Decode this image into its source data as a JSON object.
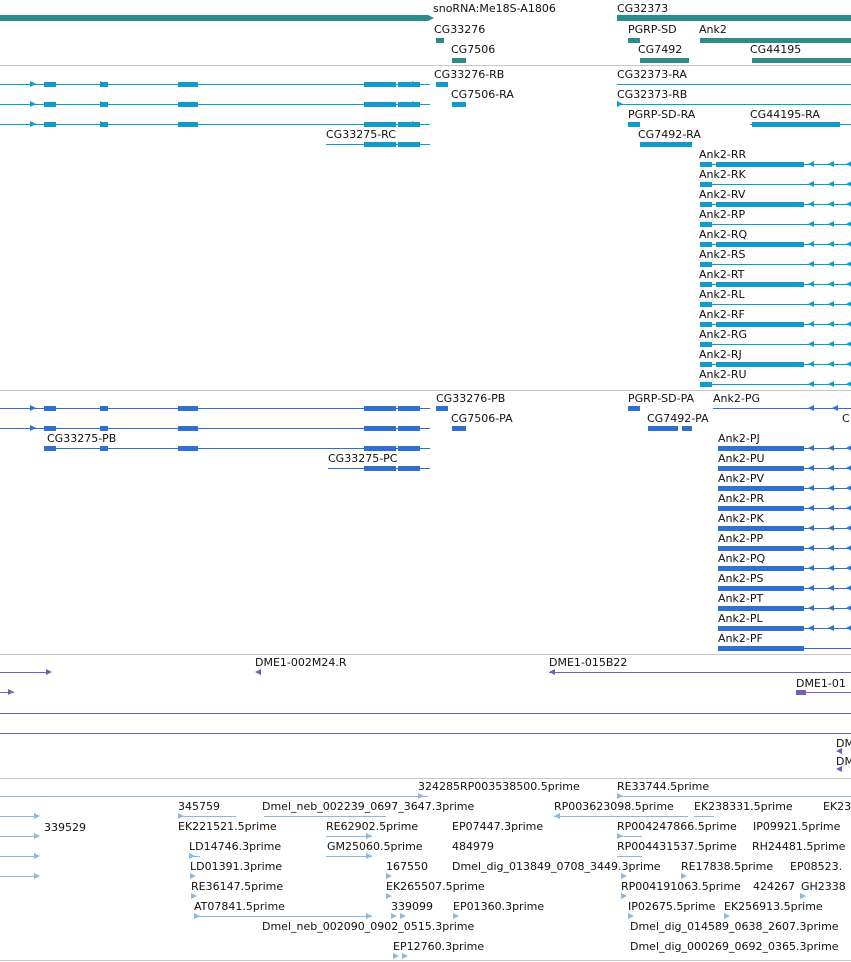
{
  "colors": {
    "gene": "#2e8b8b",
    "mrna": "#0e9ccc",
    "protein": "#2f6fd0",
    "clone": "#7a5cb8",
    "est": "#8ab8de",
    "divider": "#c8c8c8"
  },
  "tracks": [
    {
      "name": "genes",
      "color_key": "gene",
      "labels": [
        {
          "id": "g1",
          "text": "snoRNA:Me18S-A1806",
          "interactable": true
        },
        {
          "id": "g2",
          "text": "CG32373",
          "interactable": true
        },
        {
          "id": "g3",
          "text": "CG33276",
          "interactable": true
        },
        {
          "id": "g4",
          "text": "PGRP-SD",
          "interactable": true
        },
        {
          "id": "g5",
          "text": "Ank2",
          "interactable": true
        },
        {
          "id": "g6",
          "text": "CG7506",
          "interactable": true
        },
        {
          "id": "g7",
          "text": "CG7492",
          "interactable": true
        },
        {
          "id": "g8",
          "text": "CG44195",
          "interactable": true
        }
      ]
    },
    {
      "name": "transcripts",
      "color_key": "mrna",
      "labels": [
        {
          "id": "t1",
          "text": "CG33276-RB"
        },
        {
          "id": "t2",
          "text": "CG32373-RA"
        },
        {
          "id": "t3",
          "text": "CG7506-RA"
        },
        {
          "id": "t4",
          "text": "CG32373-RB"
        },
        {
          "id": "t5",
          "text": "PGRP-SD-RA"
        },
        {
          "id": "t6",
          "text": "CG44195-RA"
        },
        {
          "id": "t7",
          "text": "CG33275-RC"
        },
        {
          "id": "t8",
          "text": "CG7492-RA"
        },
        {
          "id": "t9",
          "text": "Ank2-RR"
        },
        {
          "id": "t10",
          "text": "Ank2-RK"
        },
        {
          "id": "t11",
          "text": "Ank2-RV"
        },
        {
          "id": "t12",
          "text": "Ank2-RP"
        },
        {
          "id": "t13",
          "text": "Ank2-RQ"
        },
        {
          "id": "t14",
          "text": "Ank2-RS"
        },
        {
          "id": "t15",
          "text": "Ank2-RT"
        },
        {
          "id": "t16",
          "text": "Ank2-RL"
        },
        {
          "id": "t17",
          "text": "Ank2-RF"
        },
        {
          "id": "t18",
          "text": "Ank2-RG"
        },
        {
          "id": "t19",
          "text": "Ank2-RJ"
        },
        {
          "id": "t20",
          "text": "Ank2-RU"
        }
      ]
    },
    {
      "name": "proteins",
      "color_key": "protein",
      "labels": [
        {
          "id": "p1",
          "text": "CG33276-PB"
        },
        {
          "id": "p2",
          "text": "PGRP-SD-PA"
        },
        {
          "id": "p3",
          "text": "Ank2-PG"
        },
        {
          "id": "p4",
          "text": "CG7506-PA"
        },
        {
          "id": "p5",
          "text": "CG7492-PA"
        },
        {
          "id": "p6",
          "text": "C"
        },
        {
          "id": "p7",
          "text": "CG33275-PB"
        },
        {
          "id": "p8",
          "text": "Ank2-PJ"
        },
        {
          "id": "p9",
          "text": "CG33275-PC"
        },
        {
          "id": "p10",
          "text": "Ank2-PU"
        },
        {
          "id": "p11",
          "text": "Ank2-PV"
        },
        {
          "id": "p12",
          "text": "Ank2-PR"
        },
        {
          "id": "p13",
          "text": "Ank2-PK"
        },
        {
          "id": "p14",
          "text": "Ank2-PP"
        },
        {
          "id": "p15",
          "text": "Ank2-PQ"
        },
        {
          "id": "p16",
          "text": "Ank2-PS"
        },
        {
          "id": "p17",
          "text": "Ank2-PT"
        },
        {
          "id": "p18",
          "text": "Ank2-PL"
        },
        {
          "id": "p19",
          "text": "Ank2-PF"
        }
      ]
    },
    {
      "name": "clones",
      "color_key": "clone",
      "labels": [
        {
          "id": "c1",
          "text": "DME1-002M24.R"
        },
        {
          "id": "c2",
          "text": "DME1-015B22"
        },
        {
          "id": "c3",
          "text": "DME1-01"
        },
        {
          "id": "c4",
          "text": "DM"
        },
        {
          "id": "c5",
          "text": "DM"
        }
      ]
    },
    {
      "name": "ests",
      "color_key": "est",
      "labels": [
        {
          "id": "e1",
          "text": "324285RP003538500.5prime"
        },
        {
          "id": "e2",
          "text": "RE33744.5prime"
        },
        {
          "id": "e3",
          "text": "345759"
        },
        {
          "id": "e4",
          "text": "Dmel_neb_002239_0697_3647.3prime"
        },
        {
          "id": "e5",
          "text": "RP003623098.5prime"
        },
        {
          "id": "e6",
          "text": "EK238331.5prime"
        },
        {
          "id": "e7",
          "text": "EK23"
        },
        {
          "id": "e8",
          "text": "339529"
        },
        {
          "id": "e9",
          "text": "EK221521.5prime"
        },
        {
          "id": "e10",
          "text": "RE62902.5prime"
        },
        {
          "id": "e11",
          "text": "EP07447.3prime"
        },
        {
          "id": "e12",
          "text": "RP004247866.5prime"
        },
        {
          "id": "e13",
          "text": "IP09921.5prime"
        },
        {
          "id": "e14",
          "text": "LD14746.3prime"
        },
        {
          "id": "e15",
          "text": "GM25060.5prime"
        },
        {
          "id": "e16",
          "text": "484979"
        },
        {
          "id": "e17",
          "text": "RP004431537.5prime"
        },
        {
          "id": "e18",
          "text": "RH24481.5prime"
        },
        {
          "id": "e19",
          "text": "LD01391.3prime"
        },
        {
          "id": "e20",
          "text": "167550"
        },
        {
          "id": "e21",
          "text": "Dmel_dig_013849_0708_3449.3prime"
        },
        {
          "id": "e22",
          "text": "RE17838.5prime"
        },
        {
          "id": "e23",
          "text": "EP08523."
        },
        {
          "id": "e24",
          "text": "RE36147.5prime"
        },
        {
          "id": "e25",
          "text": "EK265507.5prime"
        },
        {
          "id": "e26",
          "text": "RP004191063.5prime"
        },
        {
          "id": "e27",
          "text": "424267"
        },
        {
          "id": "e28",
          "text": "GH2338"
        },
        {
          "id": "e29",
          "text": "AT07841.5prime"
        },
        {
          "id": "e30",
          "text": "339099"
        },
        {
          "id": "e31",
          "text": "EP01360.3prime"
        },
        {
          "id": "e32",
          "text": "IP02675.5prime"
        },
        {
          "id": "e33",
          "text": "EK256913.5prime"
        },
        {
          "id": "e34",
          "text": "Dmel_neb_002090_0902_0515.3prime"
        },
        {
          "id": "e35",
          "text": "Dmel_dig_014589_0638_2607.3prime"
        },
        {
          "id": "e36",
          "text": "EP12760.3prime"
        },
        {
          "id": "e37",
          "text": "Dmel_dig_000269_0692_0365.3prime"
        }
      ]
    }
  ]
}
